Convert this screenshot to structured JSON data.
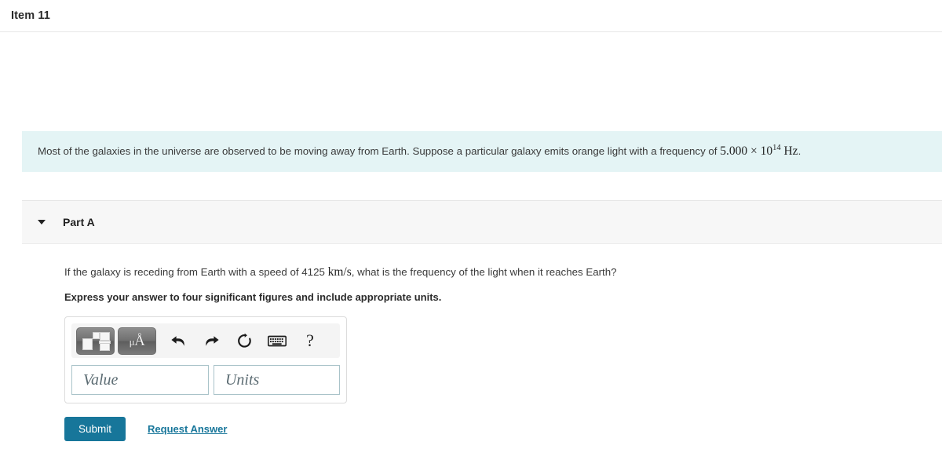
{
  "header": {
    "item_label": "Item 11"
  },
  "problem": {
    "text_before": "Most of the galaxies in the universe are observed to be moving away from Earth. Suppose a particular galaxy emits orange light with a frequency of ",
    "frequency_mantissa": "5.000",
    "frequency_times": "×",
    "frequency_base": "10",
    "frequency_exponent": "14",
    "frequency_unit": "Hz",
    "period": ".",
    "background_color": "#e4f4f5"
  },
  "part": {
    "label": "Part A",
    "caret_icon": "chevron-down-icon",
    "question_before": "If the galaxy is receding from Earth with a speed of 4125 ",
    "question_unit": "km/s",
    "question_after": ", what is the frequency of the light when it reaches Earth?",
    "instruction": "Express your answer to four significant figures and include appropriate units."
  },
  "answer_widget": {
    "toolbar": {
      "template_button": {
        "name": "math-template-button",
        "tooltip": "Templates"
      },
      "units_button": {
        "name": "units-button",
        "mu": "μ",
        "angstrom": "Å"
      },
      "undo": "undo-icon",
      "redo": "redo-icon",
      "reset": "reset-icon",
      "keyboard": "keyboard-icon",
      "help": "?"
    },
    "value_field": {
      "placeholder": "Value",
      "value": ""
    },
    "units_field": {
      "placeholder": "Units",
      "value": ""
    }
  },
  "actions": {
    "submit_label": "Submit",
    "request_answer_label": "Request Answer",
    "accent_color": "#17769a"
  }
}
